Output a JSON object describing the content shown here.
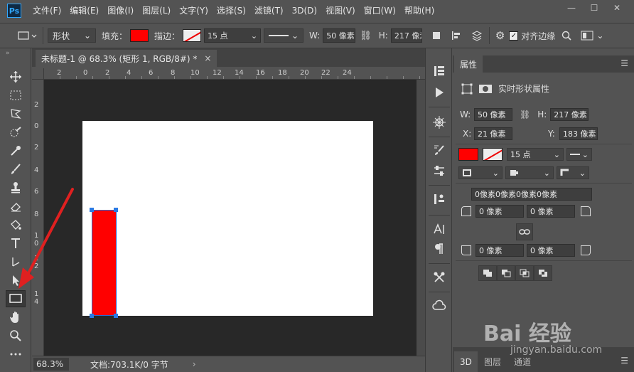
{
  "app": {
    "logo": "Ps"
  },
  "menu": [
    "文件(F)",
    "编辑(E)",
    "图像(I)",
    "图层(L)",
    "文字(Y)",
    "选择(S)",
    "滤镜(T)",
    "3D(D)",
    "视图(V)",
    "窗口(W)",
    "帮助(H)"
  ],
  "window_controls": {
    "minimize": "—",
    "maximize": "☐",
    "close": "✕"
  },
  "options_bar": {
    "mode": "形状",
    "fill_label": "填充：",
    "fill_color": "#ff0000",
    "stroke_label": "描边：",
    "stroke_size": "15 点",
    "w_label": "W:",
    "w_value": "50 像素",
    "h_label": "H:",
    "h_value": "217 像素",
    "align_edges_label": "对齐边缘"
  },
  "document": {
    "tab_title": "未标题-1 @ 68.3% (矩形 1, RGB/8#) *",
    "tab_close": "×",
    "ruler_top": [
      "2",
      "0",
      "2",
      "4",
      "6",
      "8",
      "10",
      "12",
      "14",
      "16",
      "18",
      "20",
      "22",
      "24"
    ],
    "ruler_left": [
      "2",
      "0",
      "2",
      "4",
      "6",
      "8",
      "1 0",
      "1 2",
      "1 4"
    ],
    "shape_color": "#ff0000"
  },
  "status": {
    "zoom": "68.3%",
    "doc_info": "文档:703.1K/0 字节",
    "arrow": "›"
  },
  "properties": {
    "tab": "属性",
    "section_title": "实时形状属性",
    "w_label": "W:",
    "w_value": "50 像素",
    "h_label": "H:",
    "h_value": "217 像素",
    "x_label": "X:",
    "x_value": "21 像素",
    "y_label": "Y:",
    "y_value": "183 像素",
    "fill_color": "#ff0000",
    "stroke_size": "15 点",
    "corners_all": "0像素0像素0像素0像素",
    "corner_tl": "0 像素",
    "corner_tr": "0 像素",
    "corner_bl": "0 像素",
    "corner_br": "0 像素"
  },
  "bottom_tabs": [
    "3D",
    "图层",
    "通道"
  ],
  "watermark": {
    "main": "Bai 经验",
    "sub": "jingyan.baidu.com"
  },
  "annotation_color": "#e02020"
}
